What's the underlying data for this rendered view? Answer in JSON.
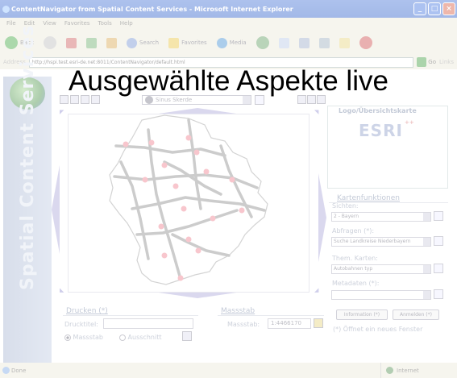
{
  "window": {
    "title": "ContentNavigator from Spatial Content Services - Microsoft Internet Explorer",
    "buttons": [
      "_",
      "□",
      "×"
    ]
  },
  "menu": [
    "File",
    "Edit",
    "View",
    "Favorites",
    "Tools",
    "Help"
  ],
  "toolbar": {
    "back": "Back",
    "search": "Search",
    "favorites": "Favorites",
    "media": "Media"
  },
  "address": {
    "label": "Address",
    "url": "http://hspi.test.esri-de.net:8011/ContentNavigator/default.html",
    "go": "Go",
    "links": "Links"
  },
  "overlay_title": "Ausgewählte Aspekte live",
  "brand_vertical": "Spatial Content Services",
  "map_toolbar": {
    "scale_select": "Sinus Skerde"
  },
  "logo_panel": {
    "title": "Logo/Übersichtskarte",
    "logo": "ESRI"
  },
  "functions_panel": {
    "title": "Kartenfunktionen",
    "views_label": "Sichten:",
    "views_value": "2 - Bayern",
    "queries_label": "Abfragen (*):",
    "queries_value": "Suche Landkreise Niederbayern",
    "thematic_label": "Them. Karten:",
    "thematic_value": "Autobahnen typ",
    "metadata_label": "Metadaten (*):",
    "metadata_value": ""
  },
  "buttons": {
    "information": "Information (*)",
    "login": "Anmelden (*)"
  },
  "note": "(*) Öffnet ein neues Fenster",
  "print": {
    "heading": "Drucken (*)",
    "title_label": "Drucktitel:",
    "title_value": "",
    "option_scale": "Massstab",
    "option_extent": "Ausschnitt"
  },
  "scale": {
    "heading": "Massstab",
    "label": "Massstab:",
    "value": "1:4466170"
  },
  "statusbar": {
    "status": "Done",
    "zone": "Internet"
  },
  "colors": {
    "titlebar": "#2458c8",
    "chrome": "#ece9d8",
    "pan_arrows": "#a8a4d8",
    "map_dots": "#f07a8a",
    "roads": "#8a8a8a"
  }
}
